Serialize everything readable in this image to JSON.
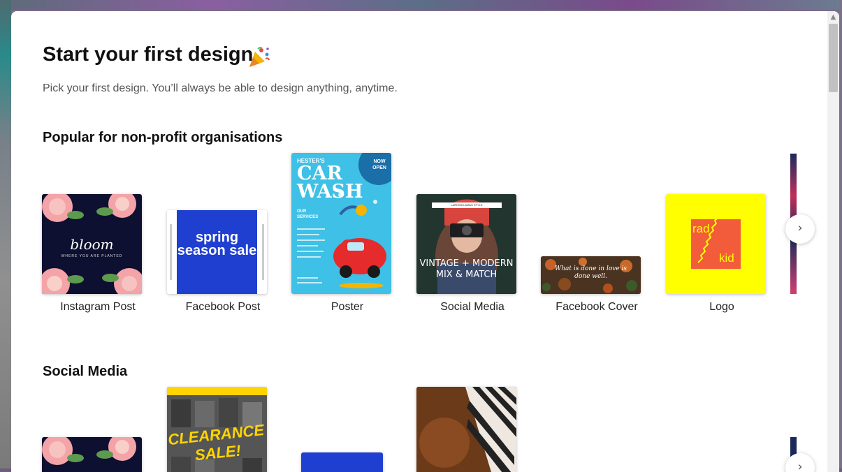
{
  "modal": {
    "title": "Start your first design",
    "subtitle": "Pick your first design. You’ll always be able to design anything, anytime."
  },
  "sections": [
    {
      "title": "Popular for non-profit organisations",
      "items": [
        {
          "label": "Instagram Post",
          "thumb_text": "bloom",
          "thumb_subtext": "WHERE YOU ARE PLANTED"
        },
        {
          "label": "Facebook Post",
          "thumb_text": "spring season sale"
        },
        {
          "label": "Poster",
          "thumb_text_1": "HESTER'S",
          "thumb_text_2": "CAR",
          "thumb_text_3": "WASH",
          "badge": "NOW OPEN",
          "services": "OUR SERVICES"
        },
        {
          "label": "Social Media",
          "thumb_banner": "LARISSA LAMAS STYLE",
          "thumb_text": "VINTAGE + MODERN MIX & MATCH"
        },
        {
          "label": "Facebook Cover",
          "thumb_text": "What is done in love is done well."
        },
        {
          "label": "Logo",
          "thumb_text_1": "rad",
          "thumb_text_2": "kid"
        }
      ]
    },
    {
      "title": "Social Media",
      "items": [
        {
          "label": "",
          "thumb_text": ""
        },
        {
          "label": "",
          "thumb_text": "CLEARANCE SALE!"
        },
        {
          "label": "",
          "thumb_text": ""
        },
        {
          "label": "",
          "thumb_text": ""
        }
      ]
    }
  ],
  "icons": {
    "confetti": "party-popper-icon",
    "next": "chevron-right-icon",
    "scroll_up": "chevron-up-icon"
  },
  "colors": {
    "poster_bg": "#3fc0e6",
    "facebook_post_bg": "#1f3fd1",
    "logo_bg": "#ffff00",
    "logo_square": "#f25c3a",
    "instagram_bg": "#0d1030",
    "clearance_yellow": "#ffd400"
  }
}
